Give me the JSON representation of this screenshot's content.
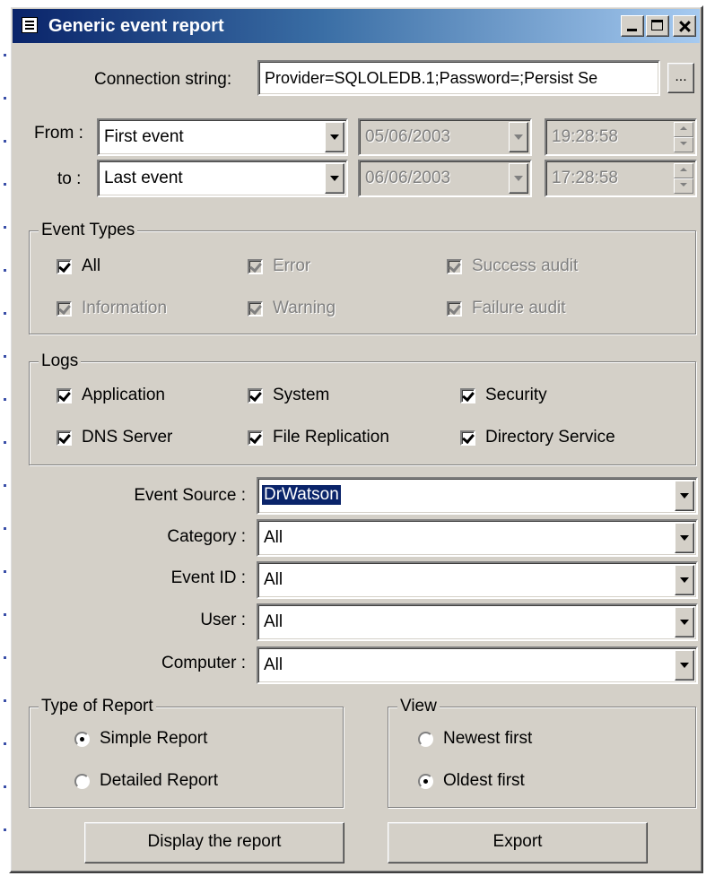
{
  "window": {
    "title": "Generic event report",
    "icon": "report-icon"
  },
  "connection": {
    "label": "Connection string:",
    "value": "Provider=SQLOLEDB.1;Password=;Persist Se",
    "browse_label": "..."
  },
  "from": {
    "label": "From :",
    "preset": "First event",
    "date": "05/06/2003",
    "time": "19:28:58"
  },
  "to": {
    "label": "to :",
    "preset": "Last event",
    "date": "06/06/2003",
    "time": "17:28:58"
  },
  "event_types": {
    "title": "Event Types",
    "items": [
      {
        "label": "All",
        "checked": true,
        "enabled": true
      },
      {
        "label": "Error",
        "checked": true,
        "enabled": false
      },
      {
        "label": "Success audit",
        "checked": true,
        "enabled": false
      },
      {
        "label": "Information",
        "checked": true,
        "enabled": false
      },
      {
        "label": "Warning",
        "checked": true,
        "enabled": false
      },
      {
        "label": "Failure audit",
        "checked": true,
        "enabled": false
      }
    ]
  },
  "logs": {
    "title": "Logs",
    "items": [
      {
        "label": "Application",
        "checked": true
      },
      {
        "label": "System",
        "checked": true
      },
      {
        "label": "Security",
        "checked": true
      },
      {
        "label": "DNS Server",
        "checked": true
      },
      {
        "label": "File Replication",
        "checked": true
      },
      {
        "label": "Directory Service",
        "checked": true
      }
    ]
  },
  "filters": {
    "event_source": {
      "label": "Event Source :",
      "value": "DrWatson"
    },
    "category": {
      "label": "Category :",
      "value": "All"
    },
    "event_id": {
      "label": "Event ID :",
      "value": "All"
    },
    "user": {
      "label": "User :",
      "value": "All"
    },
    "computer": {
      "label": "Computer :",
      "value": "All"
    }
  },
  "report_type": {
    "title": "Type of Report",
    "options": [
      {
        "label": "Simple Report",
        "selected": true
      },
      {
        "label": "Detailed Report",
        "selected": false
      }
    ]
  },
  "view": {
    "title": "View",
    "options": [
      {
        "label": "Newest first",
        "selected": false
      },
      {
        "label": "Oldest first",
        "selected": true
      }
    ]
  },
  "buttons": {
    "display": "Display the report",
    "export": "Export"
  },
  "colors": {
    "face": "#d4d0c8",
    "title_start": "#0a246a",
    "title_end": "#a6caf0",
    "highlight": "#0a246a"
  }
}
